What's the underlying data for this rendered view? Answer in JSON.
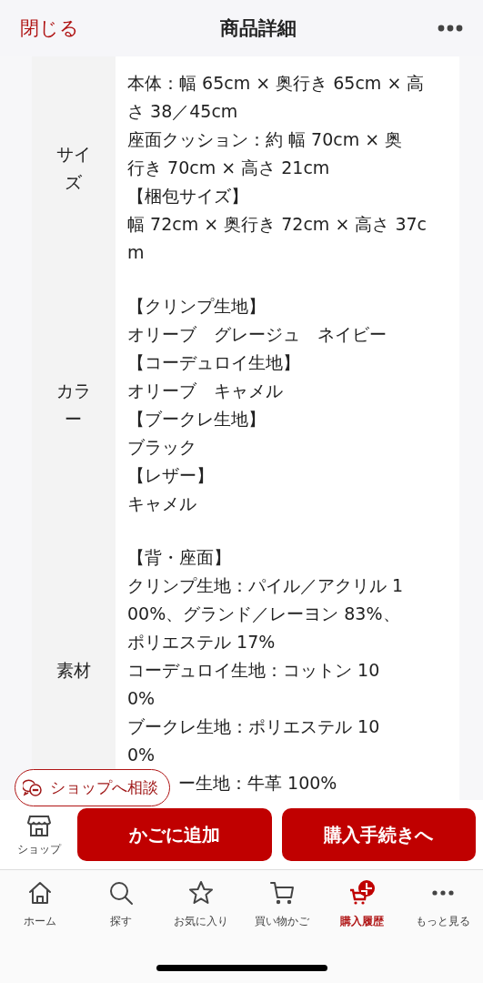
{
  "header": {
    "close": "閉じる",
    "title": "商品詳細"
  },
  "spec_rows": [
    {
      "label": "サイズ",
      "lines": [
        "本体：幅 65cm × 奥行き 65cm × 高",
        "さ 38／45cm",
        "座面クッション：約 幅 70cm × 奥",
        "行き 70cm × 高さ 21cm",
        "【梱包サイズ】",
        "幅 72cm × 奥行き 72cm × 高さ 37c",
        "m"
      ]
    },
    {
      "label": "カラー",
      "lines": [
        "【クリンプ生地】",
        "オリーブ　グレージュ　ネイビー",
        "【コーデュロイ生地】",
        "オリーブ　キャメル",
        "【ブークレ生地】",
        "ブラック",
        "【レザー】",
        "キャメル"
      ]
    },
    {
      "label": "素材",
      "lines": [
        "【背・座面】",
        "クリンプ生地：パイル／アクリル 1",
        "00%、グランド／レーヨン 83%、",
        "ポリエステル 17%",
        "コーデュロイ生地：コットン 10",
        "0%",
        "ブークレ生地：ポリエステル 10",
        "0%",
        "ー生地：牛革 100%"
      ]
    }
  ],
  "consult_button": "ショップへ相談",
  "action_bar": {
    "shop_label": "ショップ",
    "buttons": [
      "かごに追加",
      "購入手続きへ"
    ]
  },
  "tab_bar": [
    {
      "kind": "home",
      "label": "ホーム",
      "selected": false
    },
    {
      "kind": "search",
      "label": "探す",
      "selected": false
    },
    {
      "kind": "favorite",
      "label": "お気に入り",
      "selected": false
    },
    {
      "kind": "cart",
      "label": "買い物かご",
      "selected": false
    },
    {
      "kind": "history",
      "label": "購入履歴",
      "selected": true
    },
    {
      "kind": "more",
      "label": "もっと見る",
      "selected": false
    }
  ]
}
